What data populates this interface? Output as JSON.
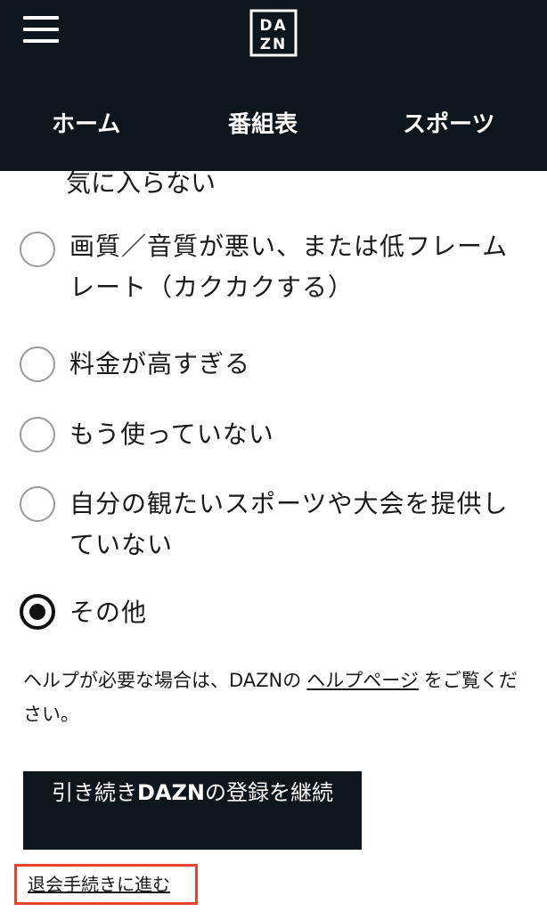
{
  "header": {
    "logo_text_top": "DA",
    "logo_text_bottom": "ZN",
    "nav": [
      {
        "label": "ホーム"
      },
      {
        "label": "番組表"
      },
      {
        "label": "スポーツ"
      }
    ]
  },
  "survey": {
    "partial_option_tail": "気に入らない",
    "options": [
      {
        "label": "画質／音質が悪い、または低フレームレート（カクカクする）",
        "selected": false
      },
      {
        "label": "料金が高すぎる",
        "selected": false
      },
      {
        "label": "もう使っていない",
        "selected": false
      },
      {
        "label": "自分の観たいスポーツや大会を提供していない",
        "selected": false
      },
      {
        "label": "その他",
        "selected": true
      }
    ]
  },
  "help": {
    "prefix": "ヘルプが必要な場合は、DAZNの",
    "link": "ヘルプページ",
    "suffix": "をご覧ください。"
  },
  "actions": {
    "continue_prefix": "引き続き",
    "continue_brand": "DAZN",
    "continue_suffix": "の登録を継続",
    "cancel_link": "退会手続きに進む"
  },
  "colors": {
    "header_bg": "#0c161c",
    "highlight_border": "#e8432e"
  }
}
